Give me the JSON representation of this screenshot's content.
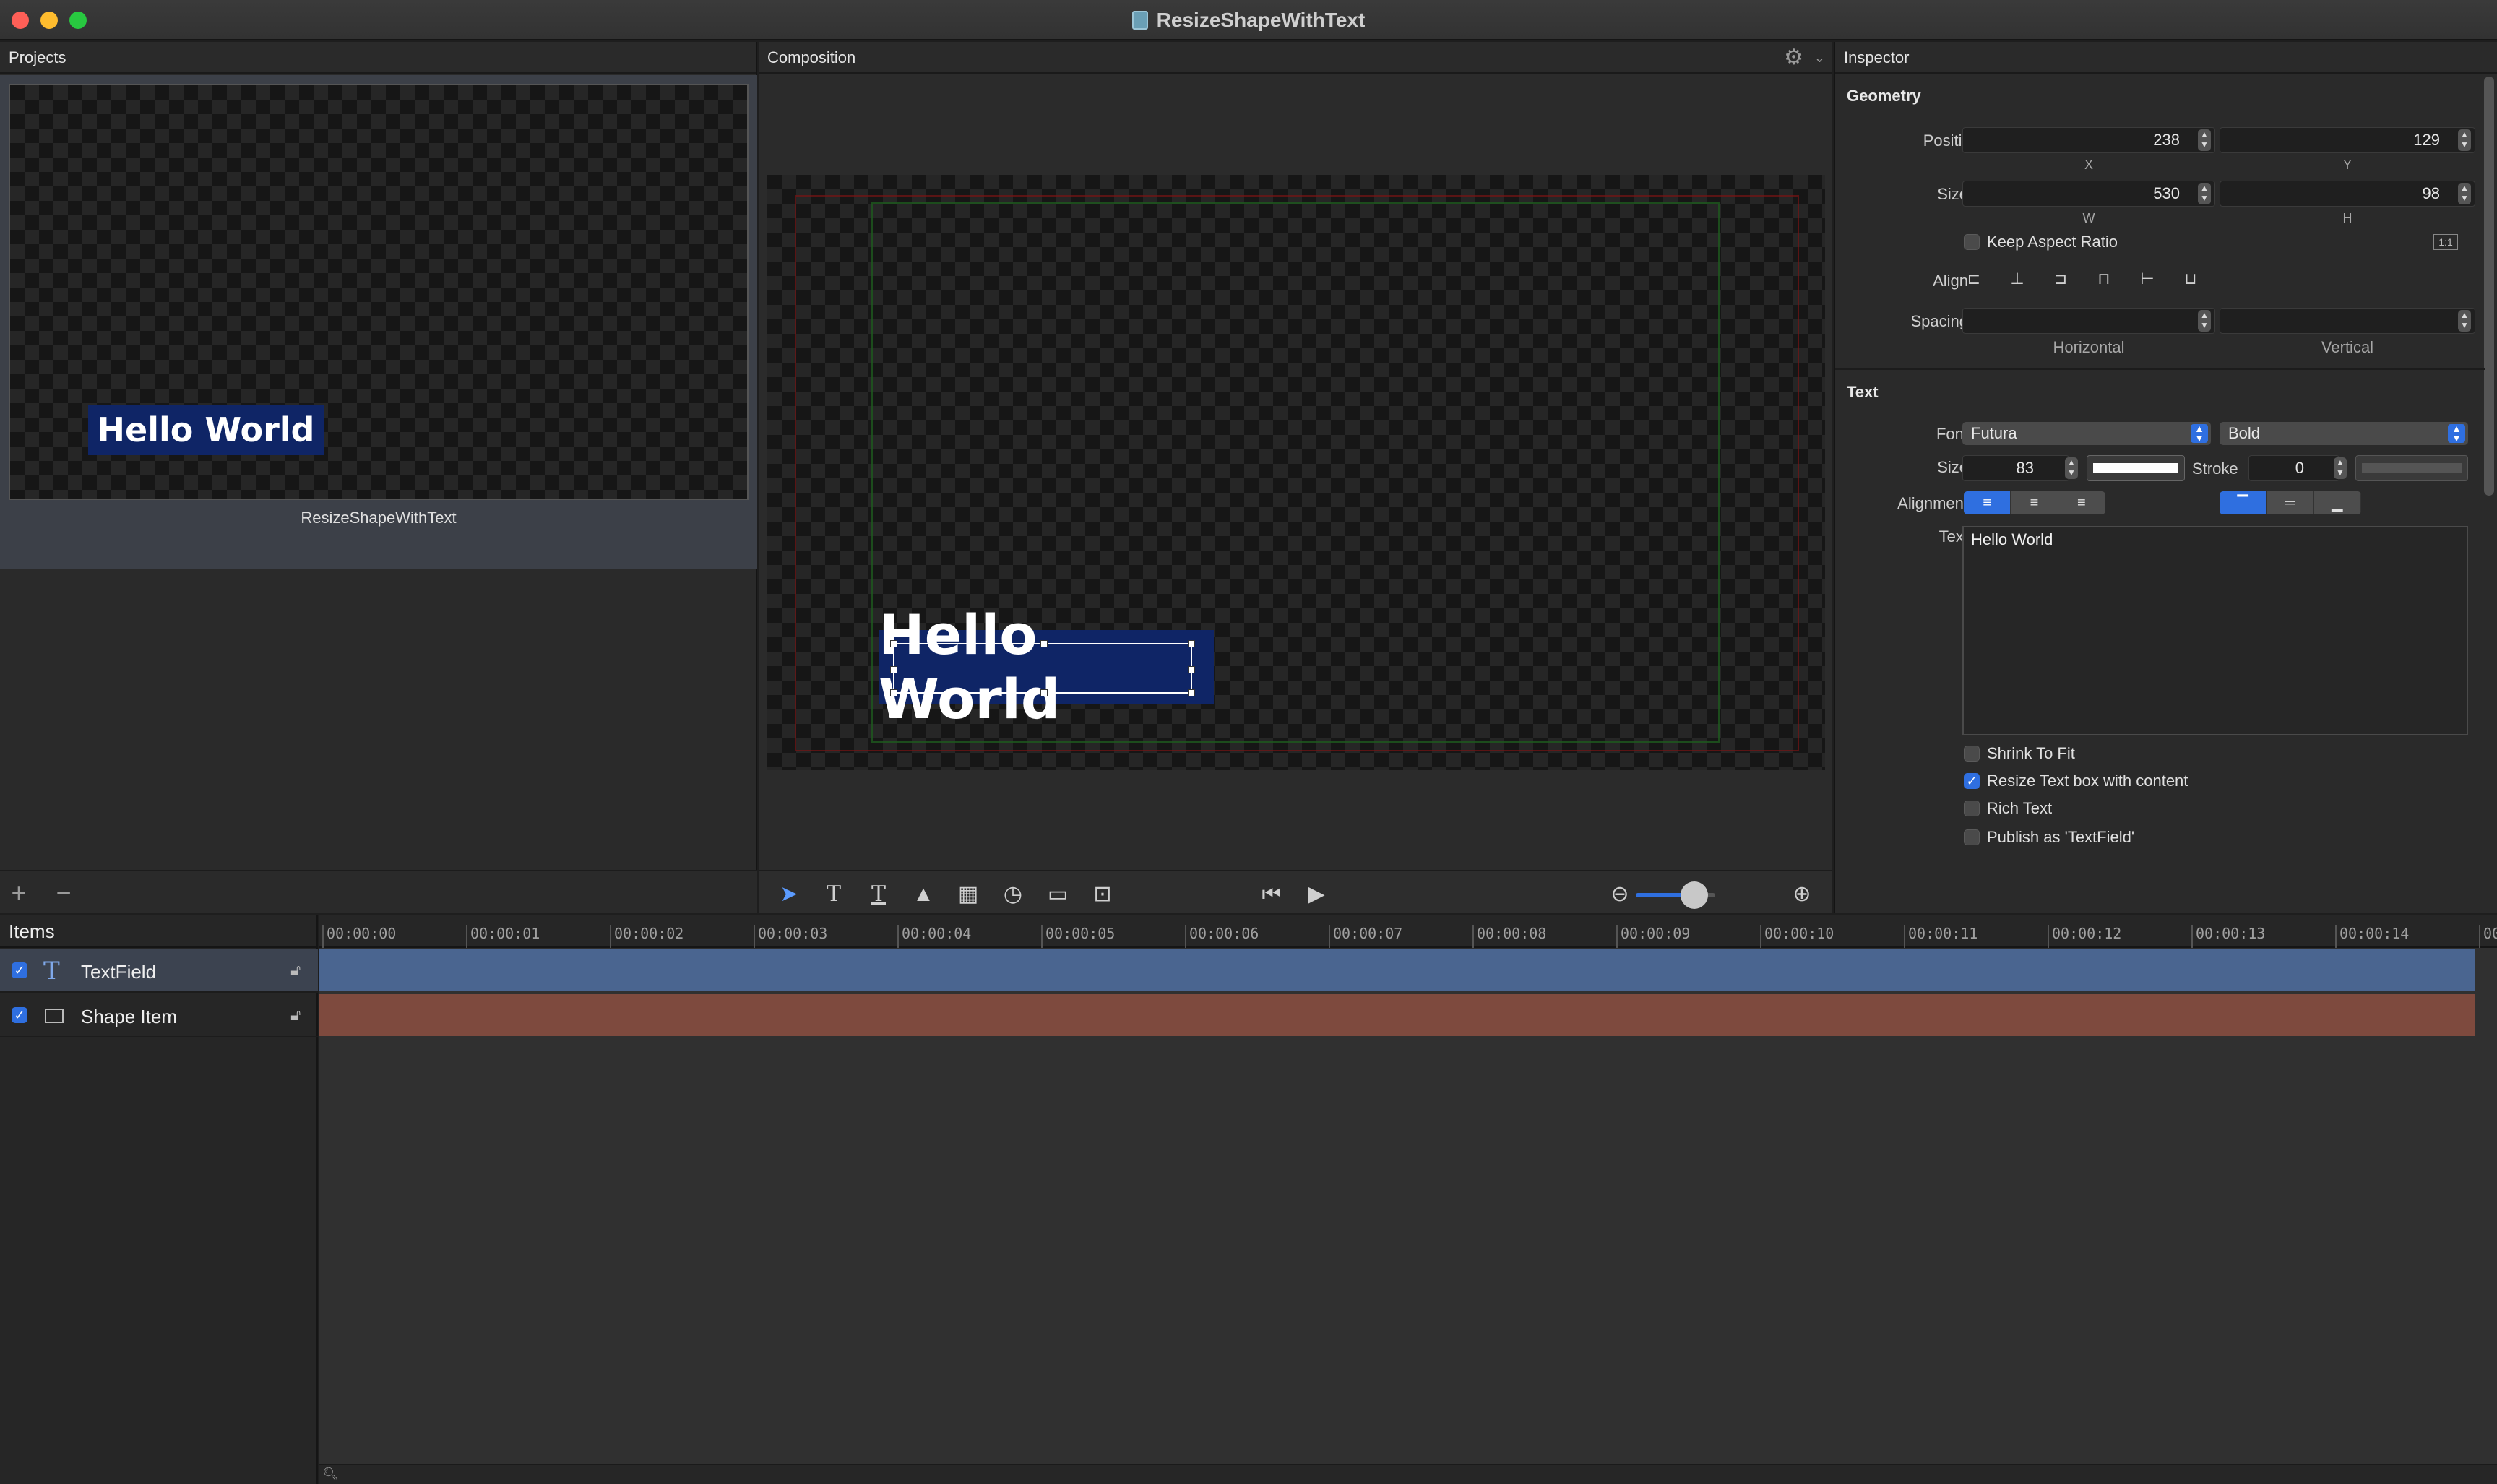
{
  "window": {
    "title": "ResizeShapeWithText",
    "traffic_colors": [
      "#fe5f57",
      "#febc2e",
      "#28c840"
    ]
  },
  "projects": {
    "header": "Projects",
    "thumbnail_text": "Hello World",
    "project_name": "ResizeShapeWithText",
    "add_label": "+",
    "remove_label": "−"
  },
  "composition": {
    "header": "Composition",
    "canvas_text": "Hello World",
    "tools": [
      "pointer-icon",
      "text-tool-icon",
      "text-box-tool-icon",
      "image-tool-icon",
      "film-tool-icon",
      "clock-tool-icon",
      "rect-tool-icon",
      "layout-tool-icon"
    ],
    "zoom_value": 0.72
  },
  "inspector": {
    "header": "Inspector",
    "geometry": {
      "title": "Geometry",
      "position_label": "Position",
      "x": "238",
      "y": "129",
      "x_label": "X",
      "y_label": "Y",
      "size_label": "Size",
      "w": "530",
      "h": "98",
      "w_label": "W",
      "h_label": "H",
      "keep_aspect_label": "Keep Aspect Ratio",
      "keep_aspect": false,
      "ratio_btn": "1:1",
      "align_label": "Align",
      "spacing_label": "Spacing",
      "horizontal_label": "Horizontal",
      "vertical_label": "Vertical"
    },
    "text": {
      "title": "Text",
      "font_label": "Font",
      "font": "Futura",
      "weight": "Bold",
      "size_label": "Size",
      "size": "83",
      "stroke_label": "Stroke",
      "stroke": "0",
      "alignment_label": "Alignment",
      "text_label": "Text",
      "text_value": "Hello World",
      "options": [
        {
          "label": "Shrink To Fit",
          "checked": false
        },
        {
          "label": "Resize Text box with content",
          "checked": true
        },
        {
          "label": "Rich Text",
          "checked": false
        },
        {
          "label": "Publish as 'TextField'",
          "checked": false
        }
      ]
    }
  },
  "timeline": {
    "items_header": "Items",
    "items": [
      {
        "name": "TextField",
        "checked": true,
        "icon": "text-icon"
      },
      {
        "name": "Shape Item",
        "checked": true,
        "icon": "rectangle-icon"
      }
    ],
    "ticks": [
      "00:00:00",
      "00:00:01",
      "00:00:02",
      "00:00:03",
      "00:00:04",
      "00:00:05",
      "00:00:06",
      "00:00:07",
      "00:00:08",
      "00:00:09",
      "00:00:10",
      "00:00:11",
      "00:00:12",
      "00:00:13",
      "00:00:14",
      "00"
    ],
    "bar_colors": {
      "text": "#4a6590",
      "shape": "#7e4a3e"
    }
  }
}
